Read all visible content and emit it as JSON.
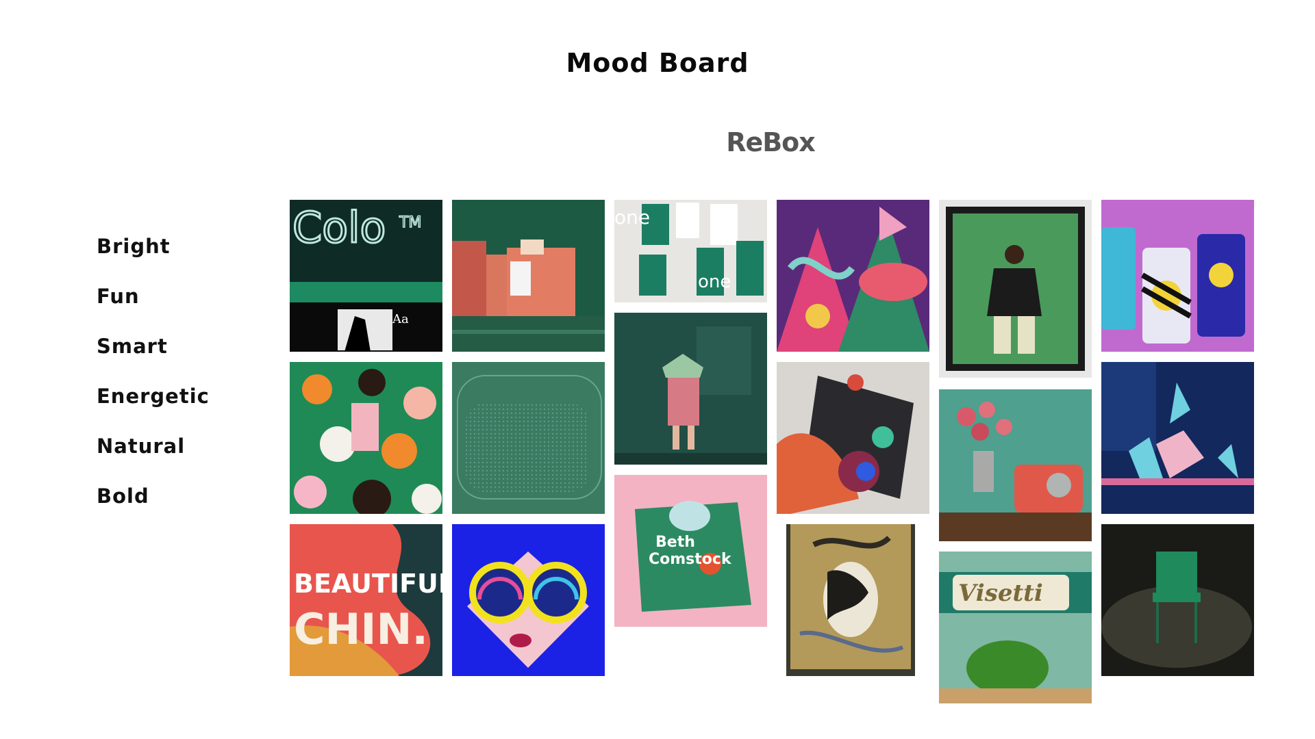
{
  "page": {
    "title": "Mood Board",
    "brand": "ReBox"
  },
  "keywords": [
    "Bright",
    "Fun",
    "Smart",
    "Energetic",
    "Natural",
    "Bold"
  ],
  "images": {
    "colo_sign": {
      "text": "Colo",
      "tm": "TM",
      "sub": "Aa"
    },
    "green_buildings": {},
    "stationery": {
      "word": "one"
    },
    "jungle": {},
    "portrait_frame": {},
    "cans": {},
    "crowd": {},
    "speaker_grille": {},
    "lampshade_figure": {},
    "abstract_shapes": {},
    "roses_radio": {},
    "hands_plants": {},
    "lettering": {
      "line1": "BEAUTIFUL",
      "line2": "CHIN."
    },
    "sunglasses": {},
    "comstock_book": {
      "line1": "Beth",
      "line2": "Comstock"
    },
    "tapestry": {},
    "visetti": {
      "word": "Visetti"
    },
    "green_chair": {}
  }
}
